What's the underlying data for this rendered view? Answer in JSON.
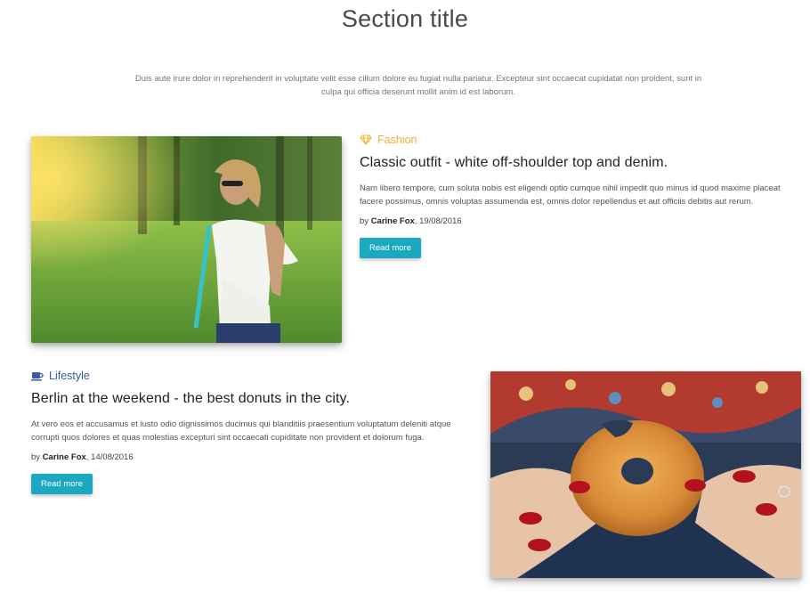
{
  "section": {
    "title": "Section title",
    "lead": "Duis aute irure dolor in reprehenderit in voluptate velit esse cillum dolore eu fugiat nulla pariatur. Excepteur sint occaecat cupidatat non proident, sunt in culpa qui officia deserunt mollit anim id est laborum."
  },
  "posts": [
    {
      "category": "Fashion",
      "category_icon": "diamond-icon",
      "category_color": "#f2b134",
      "title": "Classic outfit - white off-shoulder top and denim.",
      "excerpt": "Nam libero tempore, cum soluta nobis est eligendi optio cumque nihil impedit quo minus id quod maxime placeat facere possimus, omnis voluptas assumenda est, omnis dolor repellendus et aut officiis debitis aut rerum.",
      "author": "Carine Fox",
      "date": ", 19/08/2016",
      "by": "by ",
      "read_more": "Read more",
      "image": "photo-woman-in-park"
    },
    {
      "category": "Lifestyle",
      "category_icon": "coffee-cup-icon",
      "category_color": "#3a5ba9",
      "title": "Berlin at the weekend - the best donuts in the city.",
      "excerpt": "At vero eos et accusamus et iusto odio dignissimos ducimus qui blanditiis praesentium voluptatum deleniti atque corrupti quos dolores et quas molestias excepturi sint occaecati cupiditate non provident et dolorum fuga.",
      "author": "Carine Fox",
      "date": ", 14/08/2016",
      "by": "by ",
      "read_more": "Read more",
      "image": "photo-hands-holding-donut"
    }
  ],
  "colors": {
    "accent": "#1ba9c2"
  }
}
